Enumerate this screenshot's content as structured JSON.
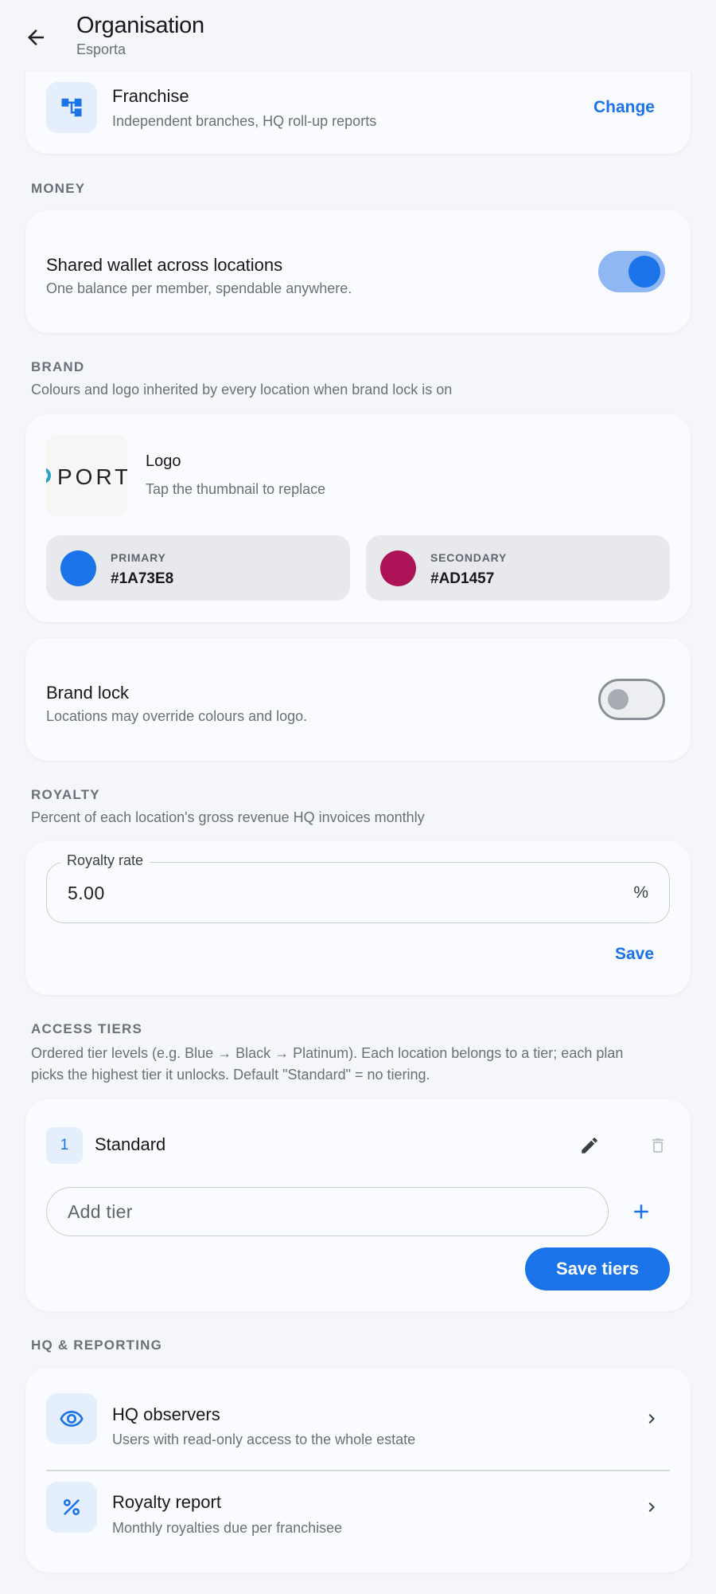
{
  "app_bar": {
    "title": "Organisation",
    "subtitle": "Esporta"
  },
  "org_type": {
    "title": "Franchise",
    "description": "Independent branches, HQ roll-up reports",
    "action_label": "Change"
  },
  "money": {
    "section_label": "MONEY",
    "shared_wallet": {
      "title": "Shared wallet across locations",
      "description": "One balance per member, spendable anywhere.",
      "enabled": true
    }
  },
  "brand": {
    "section_label": "BRAND",
    "section_description": "Colours and logo inherited by every location when brand lock is on",
    "logo": {
      "title": "Logo",
      "hint": "Tap the thumbnail to replace",
      "logo_text": "PORT"
    },
    "primary": {
      "label": "PRIMARY",
      "value": "#1A73E8",
      "color": "#1A73E8"
    },
    "secondary": {
      "label": "SECONDARY",
      "value": "#AD1457",
      "color": "#AD1457"
    },
    "brand_lock": {
      "title": "Brand lock",
      "description": "Locations may override colours and logo.",
      "enabled": false
    }
  },
  "royalty": {
    "section_label": "ROYALTY",
    "section_description": "Percent of each location's gross revenue HQ invoices monthly",
    "field_label": "Royalty rate",
    "field_value": "5.00",
    "suffix": "%",
    "save_label": "Save"
  },
  "access_tiers": {
    "section_label": "ACCESS TIERS",
    "section_description_line1": "Ordered tier levels (e.g. Blue → Black → Platinum). Each location belongs to a tier; each plan",
    "section_description_line2": "picks the highest tier it unlocks. Default \"Standard\" = no tiering.",
    "tiers": [
      {
        "rank": "1",
        "name": "Standard"
      }
    ],
    "add_placeholder": "Add tier",
    "save_label": "Save tiers"
  },
  "hq": {
    "section_label": "HQ & REPORTING",
    "items": [
      {
        "title": "HQ observers",
        "description": "Users with read-only access to the whole estate",
        "icon": "eye-icon"
      },
      {
        "title": "Royalty report",
        "description": "Monthly royalties due per franchisee",
        "icon": "percent-icon"
      }
    ]
  },
  "colors": {
    "accent": "#1A73E8",
    "background": "#F4F6FA",
    "card": "#FAFBFE",
    "tile": "#E5EEFC"
  }
}
